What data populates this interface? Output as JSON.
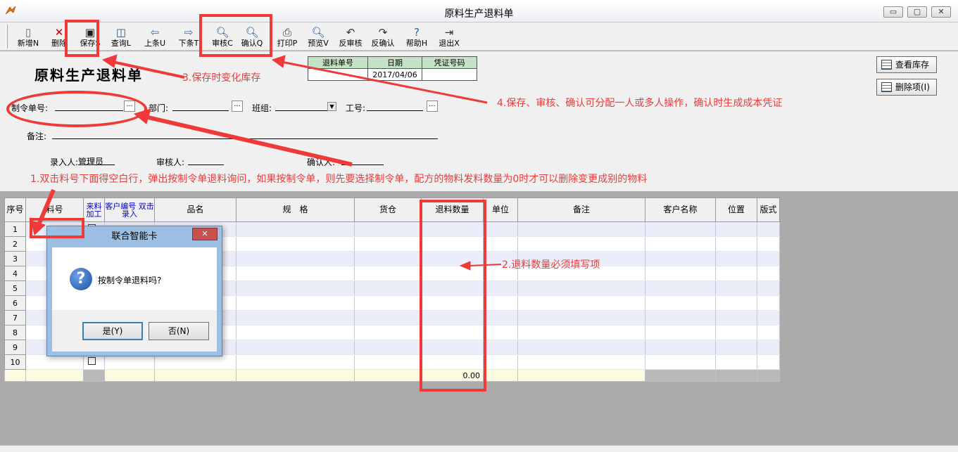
{
  "window": {
    "title": "原料生产退料单"
  },
  "toolbar": [
    {
      "name": "new",
      "label": "新增N",
      "icon": "new-doc-icon",
      "glyph": "▯",
      "color": "#666"
    },
    {
      "name": "delete",
      "label": "删除",
      "icon": "delete-x-icon",
      "glyph": "✕",
      "color": "#c00000"
    },
    {
      "name": "save",
      "label": "保存S",
      "icon": "save-disk-icon",
      "glyph": "▣",
      "color": "#1a1a1a"
    },
    {
      "name": "query",
      "label": "查询L",
      "icon": "query-doc-icon",
      "glyph": "◫",
      "color": "#2f4f7f"
    },
    {
      "name": "prev",
      "label": "上条U",
      "icon": "arrow-left-icon",
      "glyph": "⇦",
      "color": "#2f6fc0"
    },
    {
      "name": "next",
      "label": "下条T",
      "icon": "arrow-right-icon",
      "glyph": "⇨",
      "color": "#2f6fc0"
    },
    {
      "name": "review",
      "label": "审核C",
      "icon": "magnifier-icon",
      "glyph": "🔍︎",
      "color": "#1d4f91"
    },
    {
      "name": "confirm",
      "label": "确认Q",
      "icon": "magnifier-icon",
      "glyph": "🔍︎",
      "color": "#1d4f91"
    },
    {
      "name": "print",
      "label": "打印P",
      "icon": "printer-icon",
      "glyph": "⎙",
      "color": "#333"
    },
    {
      "name": "preview",
      "label": "预览V",
      "icon": "magnifier-icon",
      "glyph": "🔍︎",
      "color": "#1d4f91"
    },
    {
      "name": "unreview",
      "label": "反审核",
      "icon": "unreview-icon",
      "glyph": "↶",
      "color": "#333"
    },
    {
      "name": "unconfirm",
      "label": "反确认",
      "icon": "unconfirm-icon",
      "glyph": "↷",
      "color": "#333"
    },
    {
      "name": "help",
      "label": "帮助H",
      "icon": "help-icon",
      "glyph": "?",
      "color": "#1f5fbf"
    },
    {
      "name": "exit",
      "label": "退出X",
      "icon": "exit-door-icon",
      "glyph": "⇥",
      "color": "#333"
    }
  ],
  "form": {
    "doc_title": "原料生产退料单",
    "header_table": {
      "headers": [
        "退料单号",
        "日期",
        "凭证号码"
      ],
      "values": [
        "",
        "2017/04/06",
        ""
      ]
    },
    "labels": {
      "order_no": "制令单号:",
      "dept": "部门:",
      "team": "班组:",
      "worker_no": "工号:",
      "remark": "备注:",
      "entered_by": "录入人:",
      "entered_by_value": "管理员",
      "reviewer": "审核人:",
      "confirmer": "确认人:"
    },
    "dots": "...",
    "buttons": {
      "view_stock": "查看库存",
      "delete_item": "删除项(I)"
    }
  },
  "grid": {
    "columns": [
      "序号",
      "料号",
      "来料 加工",
      "客户编号 双击录入",
      "品名",
      "规　格",
      "货仓",
      "退料数量",
      "单位",
      "备注",
      "客户名称",
      "位置",
      "版式"
    ],
    "rows": [
      "1",
      "2",
      "3",
      "4",
      "5",
      "6",
      "7",
      "8",
      "9",
      "10"
    ],
    "total_qty": "0.00"
  },
  "dialog": {
    "title": "联合智能卡",
    "close": "✕",
    "message": "按制令单退料吗?",
    "yes": "是(Y)",
    "no": "否(N)"
  },
  "annotations": {
    "a1": "1.双击料号下面得空白行，弹出按制令单退料询问，如果按制令单，则先要选择制令单，配方的物料发料数量为0时才可以删除变更成别的物料",
    "a2": "2.退料数量必须填写项",
    "a3": "3.保存时变化库存",
    "a4": "4.保存、审核、确认可分配一人或多人操作，确认时生成成本凭证"
  }
}
